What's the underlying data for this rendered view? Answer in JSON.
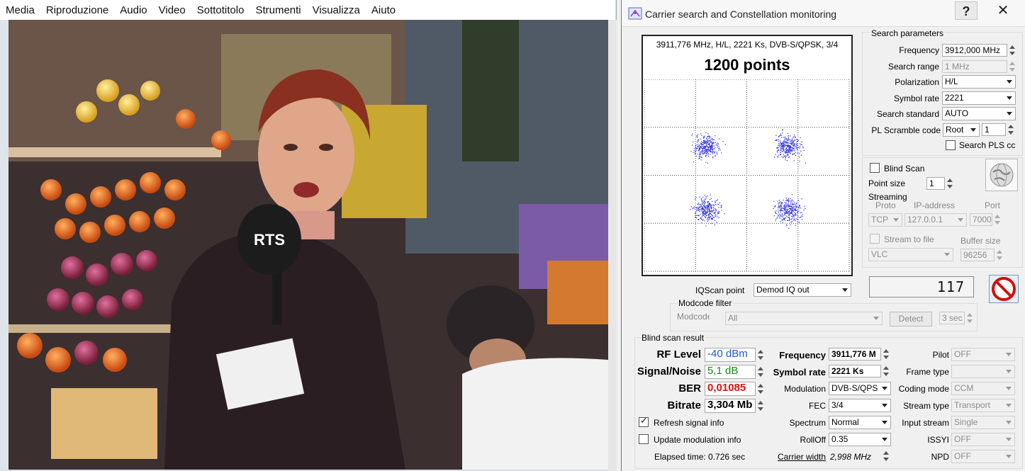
{
  "player": {
    "menu": [
      "Media",
      "Riproduzione",
      "Audio",
      "Video",
      "Sottotitolo",
      "Strumenti",
      "Visualizza",
      "Aiuto"
    ],
    "mic_logo_text": "RTS"
  },
  "window": {
    "title": "Carrier search and Constellation monitoring",
    "help_label": "?",
    "close_label": "✕"
  },
  "constellation": {
    "info": "3911,776 MHz, H/L, 2221 Ks, DVB-S/QPSK, 3/4",
    "points_label": "1200 points"
  },
  "search_params": {
    "group_label": "Search parameters",
    "frequency_label": "Frequency",
    "frequency_value": "3912,000 MHz",
    "range_label": "Search range",
    "range_value": "1 MHz",
    "polarization_label": "Polarization",
    "polarization_value": "H/L",
    "symbol_rate_label": "Symbol rate",
    "symbol_rate_value": "2221",
    "standard_label": "Search standard",
    "standard_value": "AUTO",
    "pls_label": "PL Scramble code",
    "pls_mode": "Root",
    "pls_value": "1",
    "search_pls_label": "Search PLS cc"
  },
  "scan": {
    "blind_scan_label": "Blind Scan",
    "point_size_label": "Point size",
    "point_size_value": "1"
  },
  "streaming": {
    "group_label": "Streaming",
    "proto_label": "Proto",
    "ip_label": "IP-address",
    "port_label": "Port",
    "proto_value": "TCP",
    "ip_value": "127.0.0.1",
    "port_value": "7000",
    "stream_to_file_label": "Stream to file",
    "buffer_label": "Buffer size",
    "player_value": "VLC",
    "buffer_value": "96256"
  },
  "counter_value": "117",
  "iqscan": {
    "label": "IQScan point",
    "value": "Demod IQ out"
  },
  "modcode": {
    "group_label": "Modcode filter",
    "label": "Modcode",
    "value": "All",
    "detect_label": "Detect",
    "timeout_value": "3 sec"
  },
  "result": {
    "group_label": "Blind scan result",
    "rf_label": "RF Level",
    "rf_value": "-40 dBm",
    "sn_label": "Signal/Noise",
    "sn_value": "5,1 dB",
    "ber_label": "BER",
    "ber_value": "0,01085",
    "bitrate_label": "Bitrate",
    "bitrate_value": "3,304 Mb",
    "freq_label": "Frequency",
    "freq_value": "3911,776 M",
    "sr_label": "Symbol rate",
    "sr_value": "2221 Ks",
    "mod_label": "Modulation",
    "mod_value": "DVB-S/QPS",
    "fec_label": "FEC",
    "fec_value": "3/4",
    "spectrum_label": "Spectrum",
    "spectrum_value": "Normal",
    "rolloff_label": "RollOff",
    "rolloff_value": "0.35",
    "carrier_width_label": "Carrier width",
    "carrier_width_value": "2,998 MHz",
    "pilot_label": "Pilot",
    "pilot_value": "OFF",
    "frame_label": "Frame type",
    "frame_value": "",
    "coding_label": "Coding mode",
    "coding_value": "CCM",
    "stream_type_label": "Stream type",
    "stream_type_value": "Transport",
    "input_stream_label": "Input stream",
    "input_stream_value": "Single",
    "issyi_label": "ISSYI",
    "issyi_value": "OFF",
    "npd_label": "NPD",
    "npd_value": "OFF",
    "refresh_label": "Refresh signal info",
    "update_label": "Update modulation info",
    "elapsed_label": "Elapsed time: 0.726 sec"
  },
  "colors": {
    "rf": "#1f5bd6",
    "sn": "#1a8a1a",
    "ber": "#e01010",
    "points": "#2a2ae0"
  }
}
